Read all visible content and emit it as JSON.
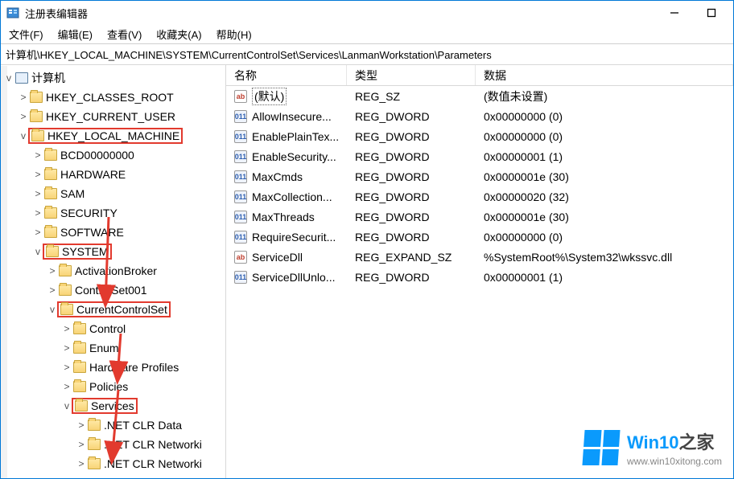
{
  "window": {
    "title": "注册表编辑器"
  },
  "menu": {
    "file": "文件(F)",
    "edit": "编辑(E)",
    "view": "查看(V)",
    "fav": "收藏夹(A)",
    "help": "帮助(H)"
  },
  "address": "计算机\\HKEY_LOCAL_MACHINE\\SYSTEM\\CurrentControlSet\\Services\\LanmanWorkstation\\Parameters",
  "tree": {
    "root": "计算机",
    "items": [
      {
        "label": "HKEY_CLASSES_ROOT",
        "depth": 1,
        "tw": ">",
        "hl": false
      },
      {
        "label": "HKEY_CURRENT_USER",
        "depth": 1,
        "tw": ">",
        "hl": false
      },
      {
        "label": "HKEY_LOCAL_MACHINE",
        "depth": 1,
        "tw": "v",
        "hl": true
      },
      {
        "label": "BCD00000000",
        "depth": 2,
        "tw": ">",
        "hl": false
      },
      {
        "label": "HARDWARE",
        "depth": 2,
        "tw": ">",
        "hl": false
      },
      {
        "label": "SAM",
        "depth": 2,
        "tw": ">",
        "hl": false
      },
      {
        "label": "SECURITY",
        "depth": 2,
        "tw": ">",
        "hl": false
      },
      {
        "label": "SOFTWARE",
        "depth": 2,
        "tw": ">",
        "hl": false
      },
      {
        "label": "SYSTEM",
        "depth": 2,
        "tw": "v",
        "hl": true
      },
      {
        "label": "ActivationBroker",
        "depth": 3,
        "tw": ">",
        "hl": false
      },
      {
        "label": "ControlSet001",
        "depth": 3,
        "tw": ">",
        "hl": false
      },
      {
        "label": "CurrentControlSet",
        "depth": 3,
        "tw": "v",
        "hl": true
      },
      {
        "label": "Control",
        "depth": 4,
        "tw": ">",
        "hl": false
      },
      {
        "label": "Enum",
        "depth": 4,
        "tw": ">",
        "hl": false
      },
      {
        "label": "Hardware Profiles",
        "depth": 4,
        "tw": ">",
        "hl": false
      },
      {
        "label": "Policies",
        "depth": 4,
        "tw": ">",
        "hl": false
      },
      {
        "label": "Services",
        "depth": 4,
        "tw": "v",
        "hl": true
      },
      {
        "label": ".NET CLR Data",
        "depth": 5,
        "tw": ">",
        "hl": false
      },
      {
        "label": ".NET CLR Networki",
        "depth": 5,
        "tw": ">",
        "hl": false
      },
      {
        "label": ".NET CLR Networki",
        "depth": 5,
        "tw": ">",
        "hl": false
      }
    ]
  },
  "cols": {
    "name": "名称",
    "type": "类型",
    "data": "数据"
  },
  "values": [
    {
      "name": "(默认)",
      "type": "REG_SZ",
      "data": "(数值未设置)",
      "icon": "str",
      "dotted": true
    },
    {
      "name": "AllowInsecure...",
      "type": "REG_DWORD",
      "data": "0x00000000 (0)",
      "icon": "bin"
    },
    {
      "name": "EnablePlainTex...",
      "type": "REG_DWORD",
      "data": "0x00000000 (0)",
      "icon": "bin"
    },
    {
      "name": "EnableSecurity...",
      "type": "REG_DWORD",
      "data": "0x00000001 (1)",
      "icon": "bin"
    },
    {
      "name": "MaxCmds",
      "type": "REG_DWORD",
      "data": "0x0000001e (30)",
      "icon": "bin"
    },
    {
      "name": "MaxCollection...",
      "type": "REG_DWORD",
      "data": "0x00000020 (32)",
      "icon": "bin"
    },
    {
      "name": "MaxThreads",
      "type": "REG_DWORD",
      "data": "0x0000001e (30)",
      "icon": "bin"
    },
    {
      "name": "RequireSecurit...",
      "type": "REG_DWORD",
      "data": "0x00000000 (0)",
      "icon": "bin"
    },
    {
      "name": "ServiceDll",
      "type": "REG_EXPAND_SZ",
      "data": "%SystemRoot%\\System32\\wkssvc.dll",
      "icon": "str"
    },
    {
      "name": "ServiceDllUnlo...",
      "type": "REG_DWORD",
      "data": "0x00000001 (1)",
      "icon": "bin"
    }
  ],
  "watermark": {
    "line1_a": "Win10",
    "line1_b": "之家",
    "line2": "www.win10xitong.com"
  }
}
